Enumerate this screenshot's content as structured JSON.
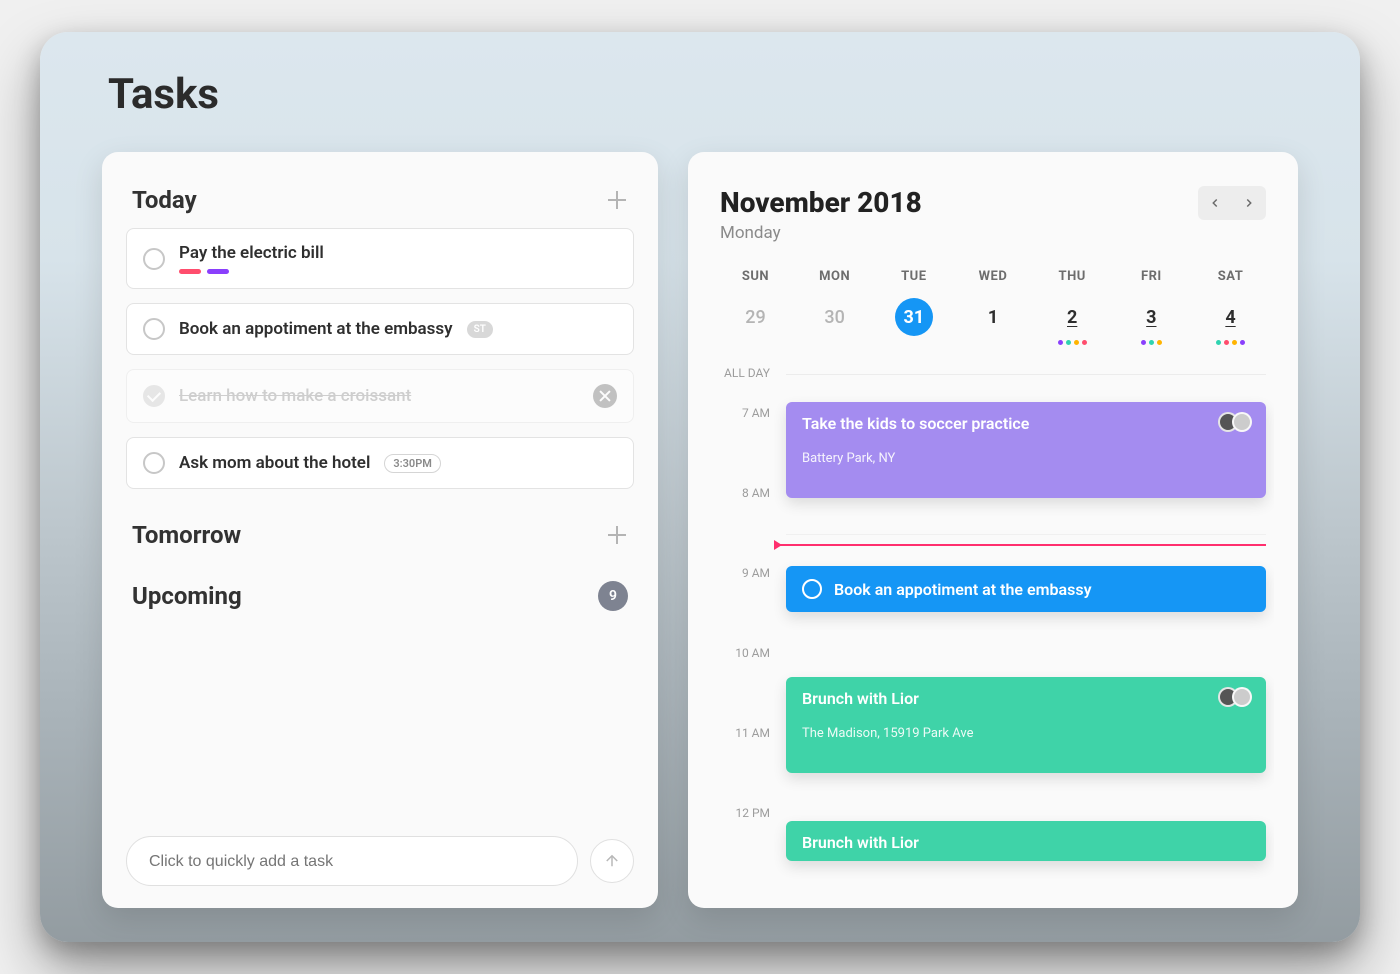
{
  "page_title": "Tasks",
  "tasks_panel": {
    "sections": {
      "today": {
        "title": "Today"
      },
      "tomorrow": {
        "title": "Tomorrow"
      },
      "upcoming": {
        "title": "Upcoming",
        "count": "9"
      }
    },
    "today_tasks": [
      {
        "text": "Pay the electric bill",
        "completed": false,
        "tag_colors": [
          "#ff4d6d",
          "#8a3ffc"
        ]
      },
      {
        "text": "Book an appotiment at the embassy",
        "completed": false,
        "badge": "ST"
      },
      {
        "text": "Learn how to make a croissant",
        "completed": true
      },
      {
        "text": "Ask mom about the hotel",
        "completed": false,
        "time": "3:30PM"
      }
    ],
    "quick_add_placeholder": "Click to quickly add a task"
  },
  "calendar_panel": {
    "title": "November 2018",
    "subtitle": "Monday",
    "day_labels": [
      "SUN",
      "MON",
      "TUE",
      "WED",
      "THU",
      "FRI",
      "SAT"
    ],
    "dates": [
      {
        "num": "29",
        "muted": true
      },
      {
        "num": "30",
        "muted": true
      },
      {
        "num": "31",
        "selected": true
      },
      {
        "num": "1"
      },
      {
        "num": "2",
        "underline": true,
        "dots": [
          "#8a3ffc",
          "#2fd3b0",
          "#ffb400",
          "#ff4d6d"
        ]
      },
      {
        "num": "3",
        "underline": true,
        "dots": [
          "#8a3ffc",
          "#2fd3b0",
          "#ffb400"
        ]
      },
      {
        "num": "4",
        "underline": true,
        "dots": [
          "#2fd3b0",
          "#ff4d6d",
          "#ffb400",
          "#8a3ffc"
        ]
      }
    ],
    "all_day_label": "ALL DAY",
    "hours": [
      "7 AM",
      "8 AM",
      "9 AM",
      "10 AM",
      "11 AM",
      "12 PM"
    ],
    "events": [
      {
        "title": "Take the kids to soccer practice",
        "location": "Battery Park, NY",
        "color": "#a48cf0",
        "has_avatars": true
      },
      {
        "title": "Book an appotiment at the embassy",
        "color": "#1596f5",
        "radio": true
      },
      {
        "title": "Brunch with Lior",
        "location": "The Madison, 15919 Park Ave",
        "color": "#3fd3a8",
        "has_avatars": true
      },
      {
        "title": "Brunch with Lior",
        "color": "#3fd3a8"
      }
    ]
  }
}
